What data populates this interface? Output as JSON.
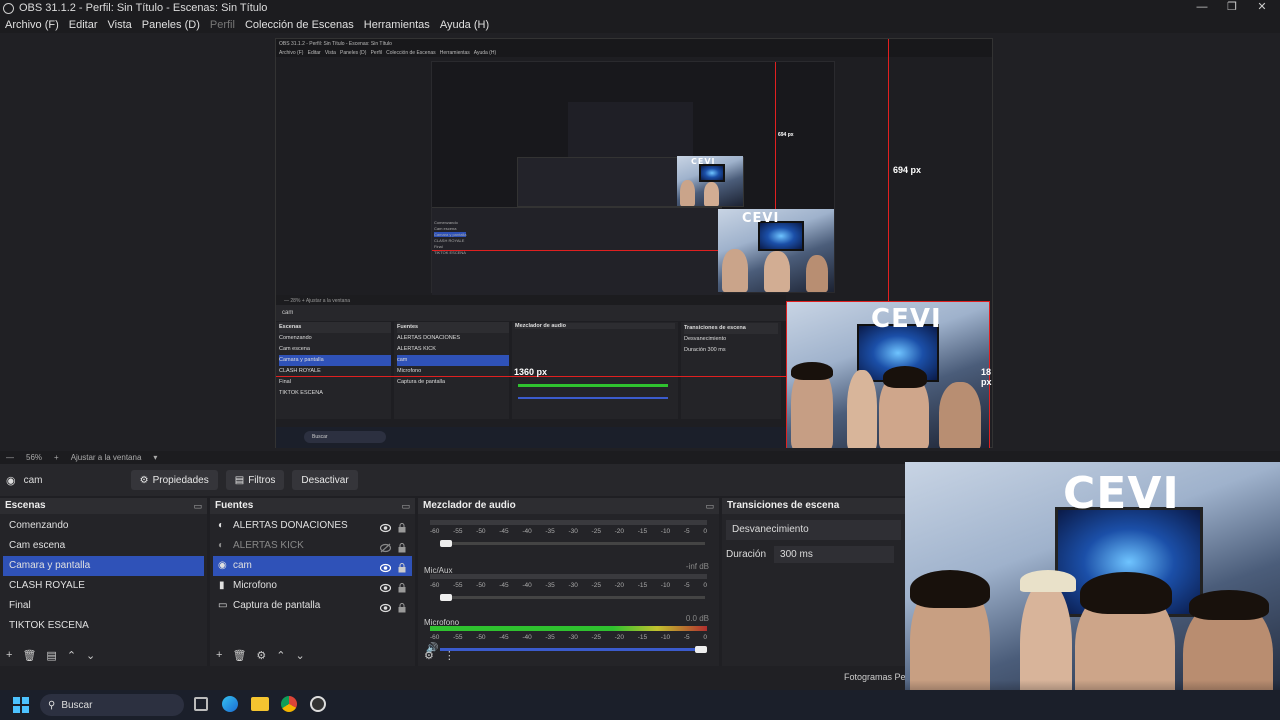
{
  "window": {
    "title": "OBS 31.1.2 - Perfil: Sin Título - Escenas: Sin Título"
  },
  "menu": {
    "items": [
      "Archivo (F)",
      "Editar",
      "Vista",
      "Paneles (D)",
      "Perfil",
      "Colección de Escenas",
      "Herramientas",
      "Ayuda (H)"
    ]
  },
  "preview": {
    "nested_title": "OBS 31.1.2 - Perfil: Sin Título - Escenas: Sin Título",
    "measure_vertical": "694 px",
    "measure_horizontal": "1360 px",
    "measure_right": "18 px",
    "nested_measure_small": "694 px",
    "camera_logo": "CEVI"
  },
  "preview_toolbar": {
    "zoom": "56%",
    "fit": "Ajustar a la ventana"
  },
  "source_toolbar": {
    "source_name": "cam",
    "properties": "Propiedades",
    "filters": "Filtros",
    "deactivate": "Desactivar"
  },
  "scenes": {
    "title": "Escenas",
    "items": [
      "Comenzando",
      "Cam escena",
      "Camara y pantalla",
      "CLASH ROYALE",
      "Final",
      "TIKTOK ESCENA"
    ],
    "selected_index": 2
  },
  "sources": {
    "title": "Fuentes",
    "items": [
      "ALERTAS DONACIONES",
      "ALERTAS KICK",
      "cam",
      "Microfono",
      "Captura de pantalla"
    ]
  },
  "mixer": {
    "title": "Mezclador de audio",
    "ticks": [
      "-60",
      "-55",
      "-50",
      "-45",
      "-40",
      "-35",
      "-30",
      "-25",
      "-20",
      "-15",
      "-10",
      "-5",
      "0"
    ],
    "channels": [
      {
        "name": "",
        "db": ""
      },
      {
        "name": "Mic/Aux",
        "db": "-inf dB"
      },
      {
        "name": "Microfono",
        "db": "0.0 dB"
      }
    ]
  },
  "transitions": {
    "title": "Transiciones de escena",
    "selected": "Desvanecimiento",
    "duration_label": "Duración",
    "duration_value": "300 ms"
  },
  "status": {
    "fps_label": "Fotogramas Pe"
  },
  "taskbar": {
    "search": "Buscar"
  }
}
